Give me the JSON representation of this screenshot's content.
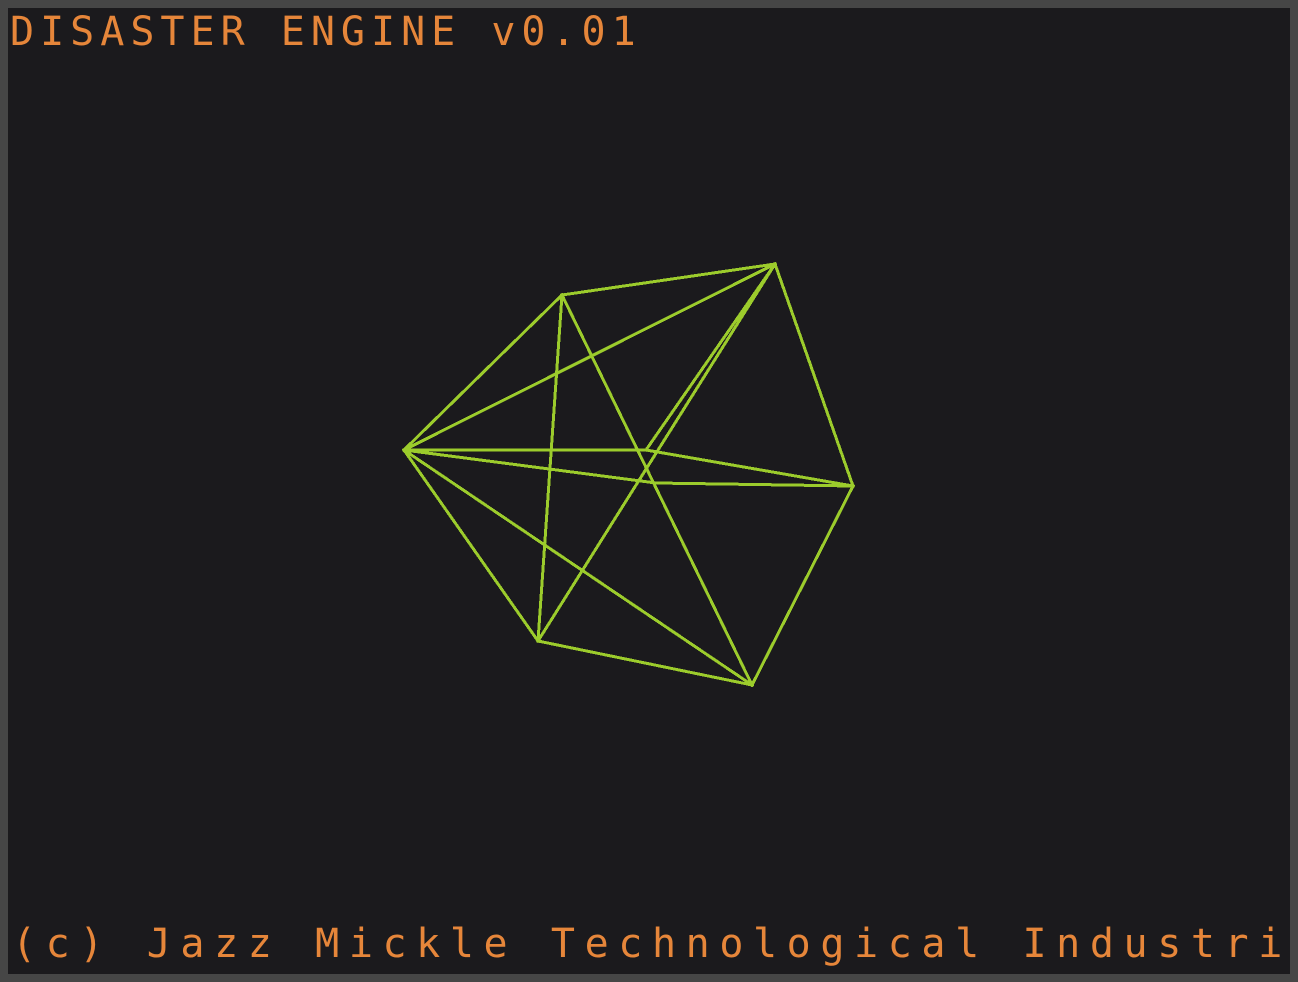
{
  "title": "DISASTER ENGINE v0.01",
  "footer": "(c) Jazz Mickle Technological Industries",
  "colors": {
    "background": "#1b1a1d",
    "border": "#464646",
    "text": "#e6863a",
    "wireframe": "#9ccc2c"
  },
  "model": {
    "shape": "icosahedron-wireframe"
  }
}
